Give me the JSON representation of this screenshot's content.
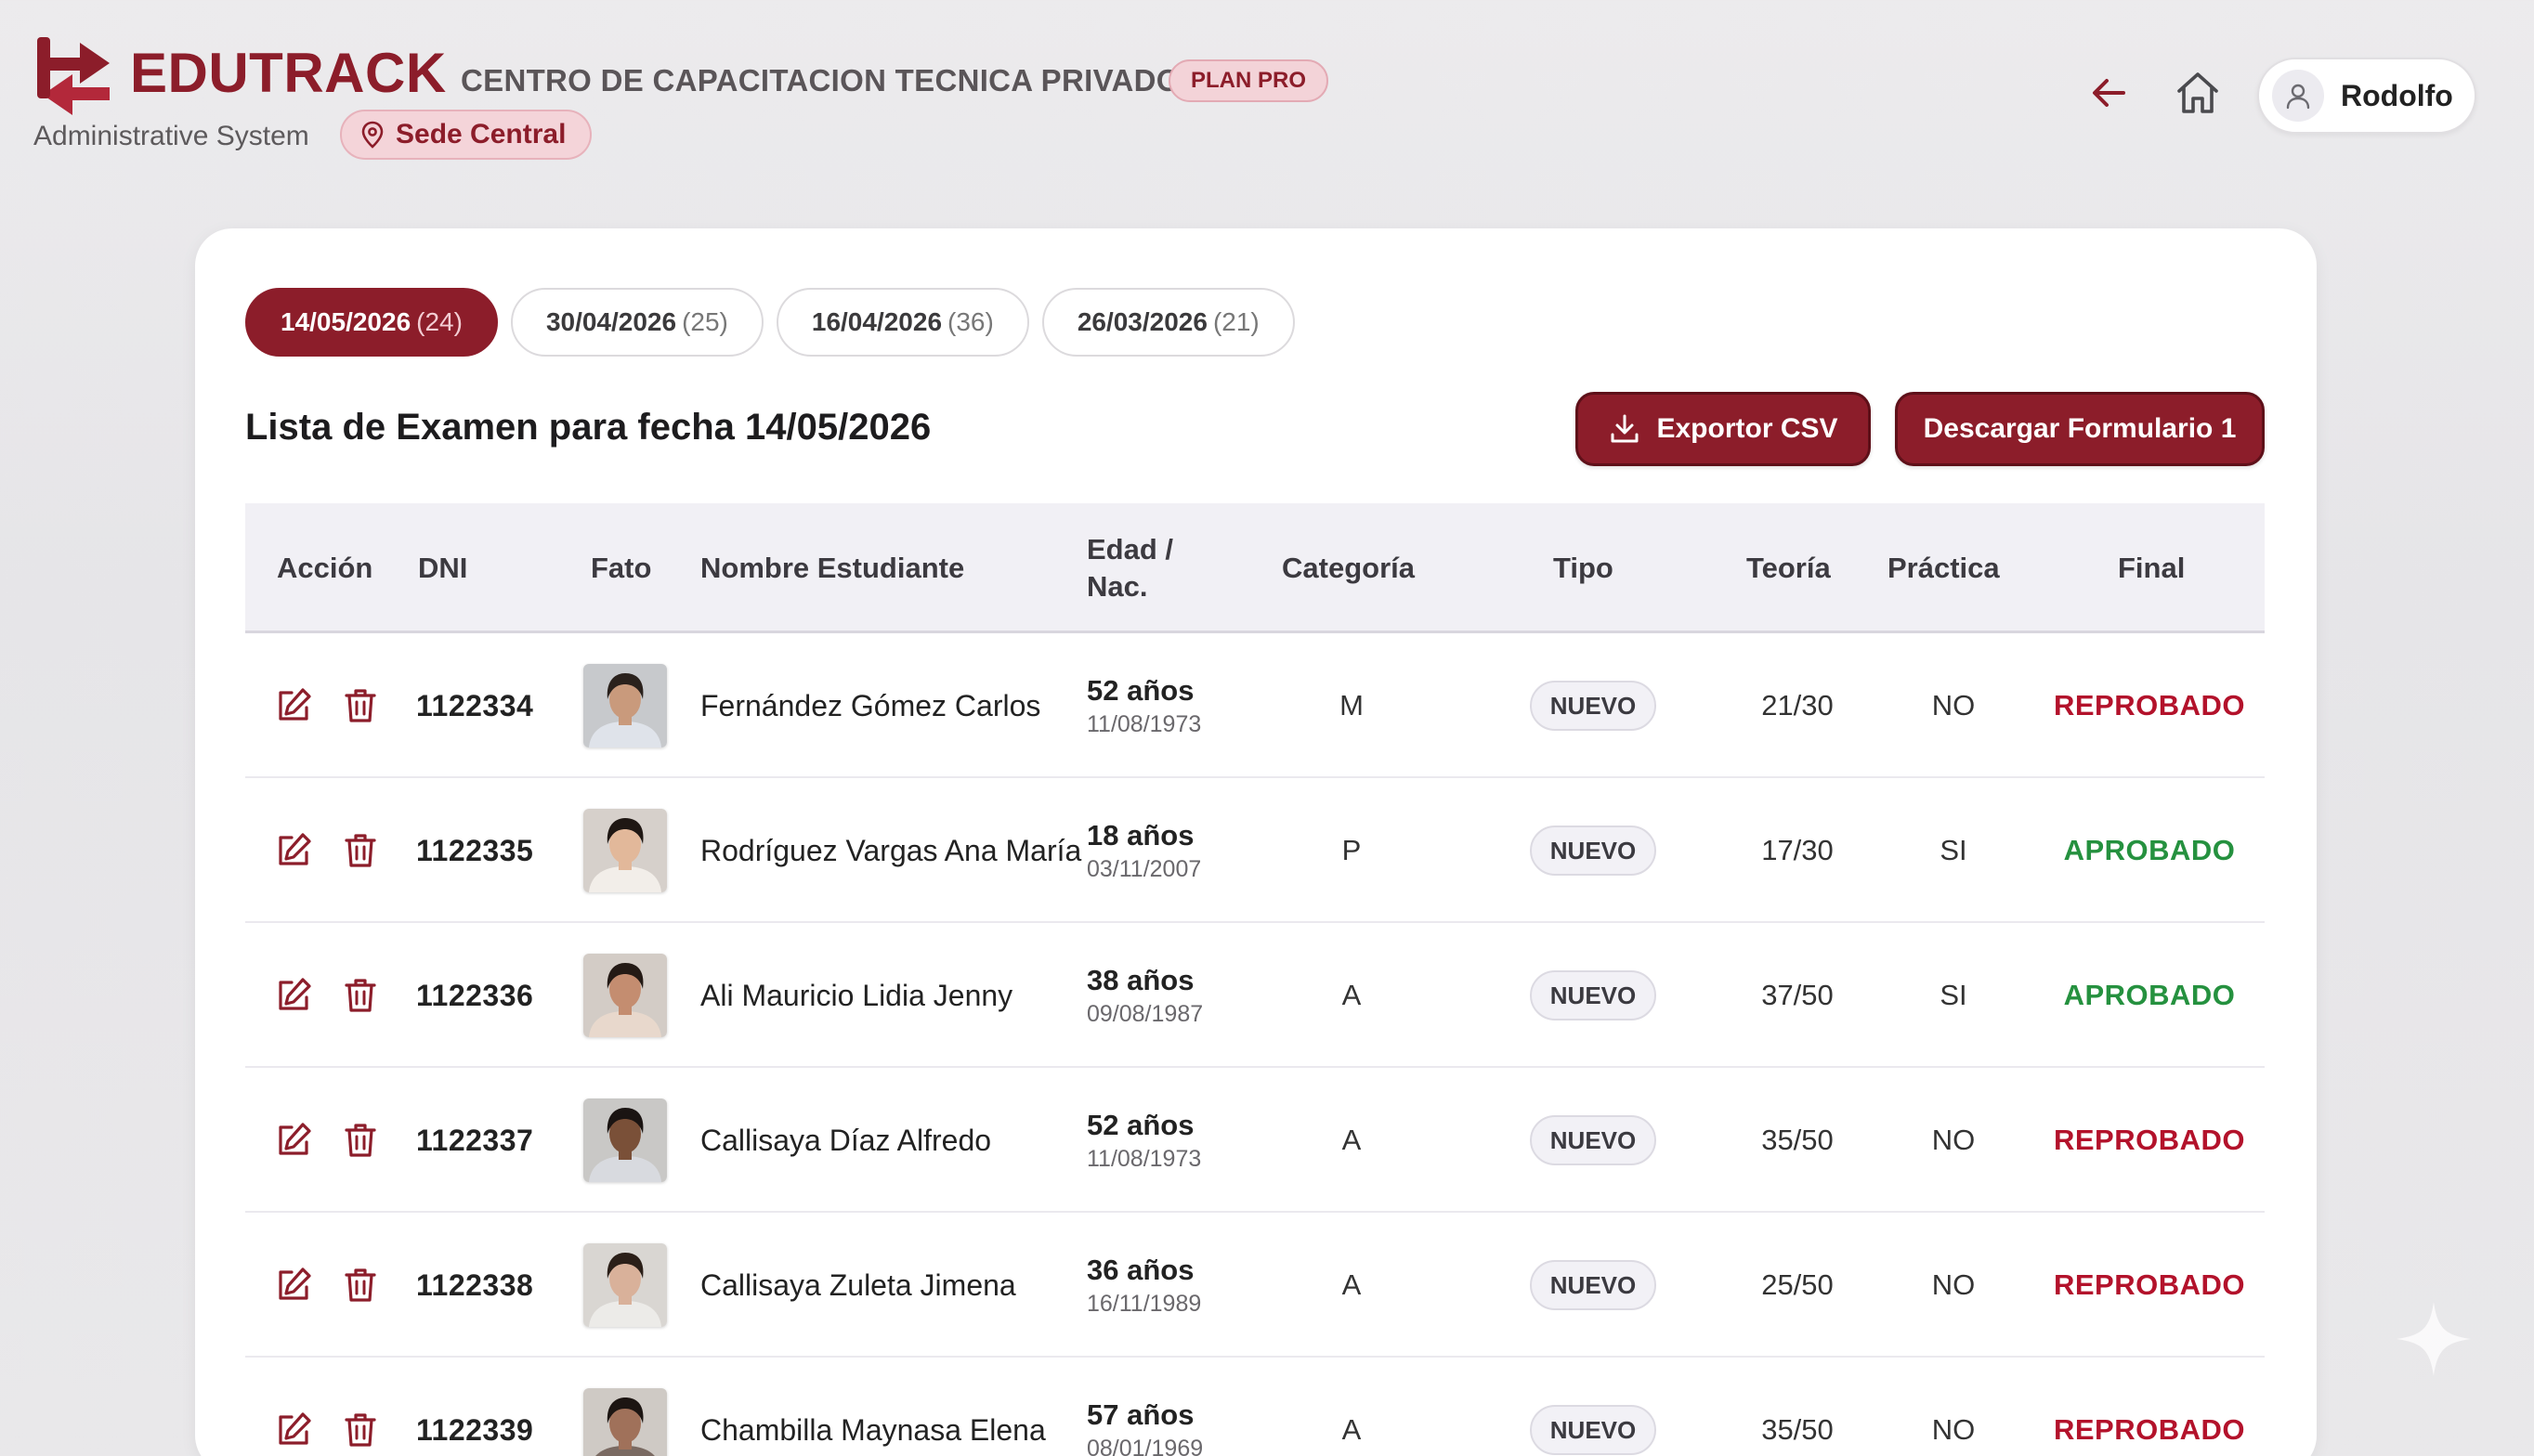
{
  "header": {
    "brand": "EDUTRACK",
    "institution": "CENTRO DE CAPACITACION TECNICA PRIVADO",
    "plan": "PLAN PRO",
    "subtitle": "Administrative System",
    "sede": "Sede Central",
    "user": "Rodolfo"
  },
  "tabs": [
    {
      "date": "14/05/2026",
      "count": "(24)",
      "active": true
    },
    {
      "date": "30/04/2026",
      "count": "(25)",
      "active": false
    },
    {
      "date": "16/04/2026",
      "count": "(36)",
      "active": false
    },
    {
      "date": "26/03/2026",
      "count": "(21)",
      "active": false
    }
  ],
  "list_title": "Lista de Examen para fecha 14/05/2026",
  "actions": {
    "export_csv": "Exportor CSV",
    "download_form": "Descargar Formulario 1"
  },
  "table": {
    "headers": {
      "accion": "Acción",
      "dni": "DNI",
      "foto": "Fato",
      "nombre": "Nombre Estudiante",
      "edad_line1": "Edad /",
      "edad_line2": "Nac.",
      "categoria": "Categoría",
      "tipo": "Tipo",
      "teoria": "Teoría",
      "practica": "Práctica",
      "final": "Final"
    },
    "rows": [
      {
        "dni": "1122334",
        "name": "Fernández Gómez Carlos",
        "age": "52 años",
        "dob": "11/08/1973",
        "cat": "M",
        "tipo": "NUEVO",
        "teoria": "21/30",
        "practica": "NO",
        "final": "REPROBADO",
        "passed": false
      },
      {
        "dni": "1122335",
        "name": "Rodríguez Vargas Ana María",
        "age": "18 años",
        "dob": "03/11/2007",
        "cat": "P",
        "tipo": "NUEVO",
        "teoria": "17/30",
        "practica": "SI",
        "final": "APROBADO",
        "passed": true
      },
      {
        "dni": "1122336",
        "name": "Ali Mauricio Lidia Jenny",
        "age": "38 años",
        "dob": "09/08/1987",
        "cat": "A",
        "tipo": "NUEVO",
        "teoria": "37/50",
        "practica": "SI",
        "final": "APROBADO",
        "passed": true
      },
      {
        "dni": "1122337",
        "name": "Callisaya Díaz Alfredo",
        "age": "52 años",
        "dob": "11/08/1973",
        "cat": "A",
        "tipo": "NUEVO",
        "teoria": "35/50",
        "practica": "NO",
        "final": "REPROBADO",
        "passed": false
      },
      {
        "dni": "1122338",
        "name": "Callisaya Zuleta Jimena",
        "age": "36 años",
        "dob": "16/11/1989",
        "cat": "A",
        "tipo": "NUEVO",
        "teoria": "25/50",
        "practica": "NO",
        "final": "REPROBADO",
        "passed": false
      },
      {
        "dni": "1122339",
        "name": "Chambilla Maynasa Elena",
        "age": "57 años",
        "dob": "08/01/1969",
        "cat": "A",
        "tipo": "NUEVO",
        "teoria": "35/50",
        "practica": "NO",
        "final": "REPROBADO",
        "passed": false
      }
    ]
  },
  "colors": {
    "brand": "#8c1d2a",
    "fail": "#b3122b",
    "pass": "#25913f"
  }
}
